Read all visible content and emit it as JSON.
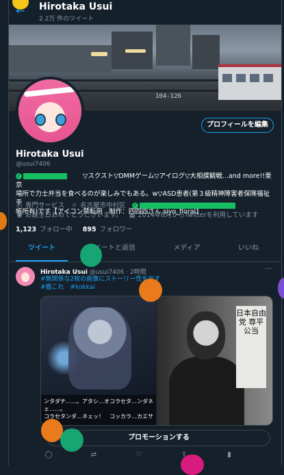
{
  "header": {
    "title": "Hirotaka Usui",
    "subtitle": "2.2万 件のツイート"
  },
  "banner": {
    "plate_text": "104-126"
  },
  "profile": {
    "edit_button": "プロフィールを編集",
    "name": "Hirotaka Usui",
    "handle": "@usui7406",
    "bio_line1": "▽スクスト▽DMMゲーム▽アイログ▽大相撲観戦...and more!!東京",
    "bio_line2": "場所で力士弁当を食べるのが楽しみでもある。w▽ASD患者(第３級精神障害者保険福祉手",
    "bio_line3": "帳所有)です【アイコン禁転用　制作：四四四さん siyo_floral】",
    "category": "専門サービス",
    "location": "名古屋市中村区",
    "birthday": "お誕生日おめでとうございます。",
    "joined": "2014年8月からTwitterを利用しています",
    "following_count": "1,123",
    "following_label": "フォロー中",
    "followers_count": "895",
    "followers_label": "フォロワー"
  },
  "tabs": [
    "ツイート",
    "ツイートと返信",
    "メディア",
    "いいね"
  ],
  "tweet": {
    "author": "Hirotaka Usui",
    "handle": "@usui7406",
    "time": "· 2時間",
    "more": "···",
    "line1": "#無関係な2枚の画像にストーリー性を出す",
    "line2": "#艦これ　#kokkai",
    "caption_line1": "ンタダチ……。アタシ…オコラセタ…ンダネェ……。",
    "caption_line2": "コラセタンダ…ネェッ！　コッカラ…カエサナイッ…",
    "sign_text": "日本自由党 尊平公当",
    "promo_button": "プロモーションする"
  },
  "colors": {
    "background": "#15202b",
    "accent": "#1da1f2",
    "muted": "#8899a6",
    "divider": "#38444d",
    "verified": "#17bf63"
  },
  "icons": [
    "back-arrow-icon",
    "briefcase-icon",
    "location-pin-icon",
    "link-icon",
    "balloon-icon",
    "calendar-icon",
    "more-icon",
    "reply-icon",
    "retweet-icon",
    "like-icon",
    "share-icon",
    "analytics-icon"
  ]
}
